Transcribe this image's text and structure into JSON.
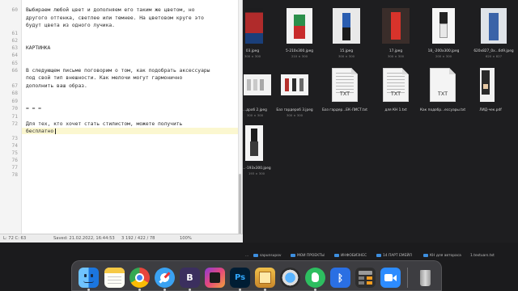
{
  "editor": {
    "line_numbers": [
      "60",
      "",
      "61",
      "62",
      "63",
      "64",
      "65",
      "66",
      "",
      "67",
      "68",
      "69",
      "70",
      "71",
      "72",
      "",
      "73",
      "74",
      "75",
      "76",
      "77",
      "78"
    ],
    "lines": [
      "Выбираем любой цвет и дополняем его таким же цветом, но",
      "другого оттенка, светлее или темнее. На цветовом круге это",
      "будут цвета из одного лучика.",
      "КАРТИНКА",
      "В следующем письме поговорим о том, как подобрать аксессуары",
      "под свой тип внешности. Как мелочи могут гармонично",
      "дополнить ваш образ.",
      "= = =",
      "Для тех, кто хочет стать стилистом, можете получить",
      "бесплатно"
    ],
    "status": {
      "position": "L: 72 C: 63",
      "saved": "Saved: 21.02.2022, 16:44:53",
      "counts": "3 192 / 422 / 78",
      "zoom": "100%"
    }
  },
  "finder": {
    "files": [
      {
        "name": "03.jpeg",
        "dims": "300 × 300"
      },
      {
        "name": "5-210x300.jpeg",
        "dims": "210 × 300"
      },
      {
        "name": "15.jpeg",
        "dims": "300 × 300"
      },
      {
        "name": "17.jpeg",
        "dims": "300 × 300"
      },
      {
        "name": "18_-200x300.jpeg",
        "dims": "200 × 300"
      },
      {
        "name": "620x827_0x...6d9.jpeg",
        "dims": "620 × 827"
      },
      {
        "name": "...дроб 2.jpeg",
        "dims": "300 × 300"
      },
      {
        "name": "Баз гардероб 3.jpeg",
        "dims": "300 × 300"
      },
      {
        "name": "Баз гардер...ЕК-ЛИСТ.txt",
        "dims": ""
      },
      {
        "name": "для КН 1.txt",
        "dims": ""
      },
      {
        "name": "Как подобр...ессуары.txt",
        "dims": ""
      },
      {
        "name": "ЛИД-чек.pdf",
        "dims": ""
      },
      {
        "name": "...-193x300.jpeg",
        "dims": "193 × 300"
      }
    ],
    "doc_ext_txt": "TXT",
    "path": [
      "...",
      "sapunsupov",
      "МОИ ПРОЕКТЫ",
      "ИНФОБИЗНЕС",
      "14 ПАРТ ЕМЕЙЛ",
      "КН для автораса",
      "1.textuars.txt"
    ]
  },
  "dock": {
    "apps": [
      {
        "name": "Finder",
        "icon": "finder-icon"
      },
      {
        "name": "Notes",
        "icon": "notes-icon"
      },
      {
        "name": "Chrome",
        "icon": "chrome-icon"
      },
      {
        "name": "Safari",
        "icon": "safari-icon"
      },
      {
        "name": "BBEdit",
        "icon": "bbedit-icon",
        "glyph": "B"
      },
      {
        "name": "Final Cut Pro",
        "icon": "final-cut-icon"
      },
      {
        "name": "Photoshop",
        "icon": "photoshop-icon",
        "glyph": "Ps"
      },
      {
        "name": "Preview",
        "icon": "preview-icon"
      },
      {
        "name": "QuickTime",
        "icon": "quicktime-icon"
      },
      {
        "name": "Evernote",
        "icon": "evernote-icon"
      },
      {
        "name": "Bluetooth",
        "icon": "bluetooth-icon"
      },
      {
        "name": "Calculator",
        "icon": "calculator-icon"
      },
      {
        "name": "Zoom",
        "icon": "zoom-icon"
      },
      {
        "name": "Trash",
        "icon": "trash-icon"
      }
    ]
  },
  "colors": {
    "desktop": "#1b1b1d",
    "editor_bg": "#ffffff",
    "current_line": "#fbf7d0",
    "folder_blue": "#3d8fe0"
  }
}
